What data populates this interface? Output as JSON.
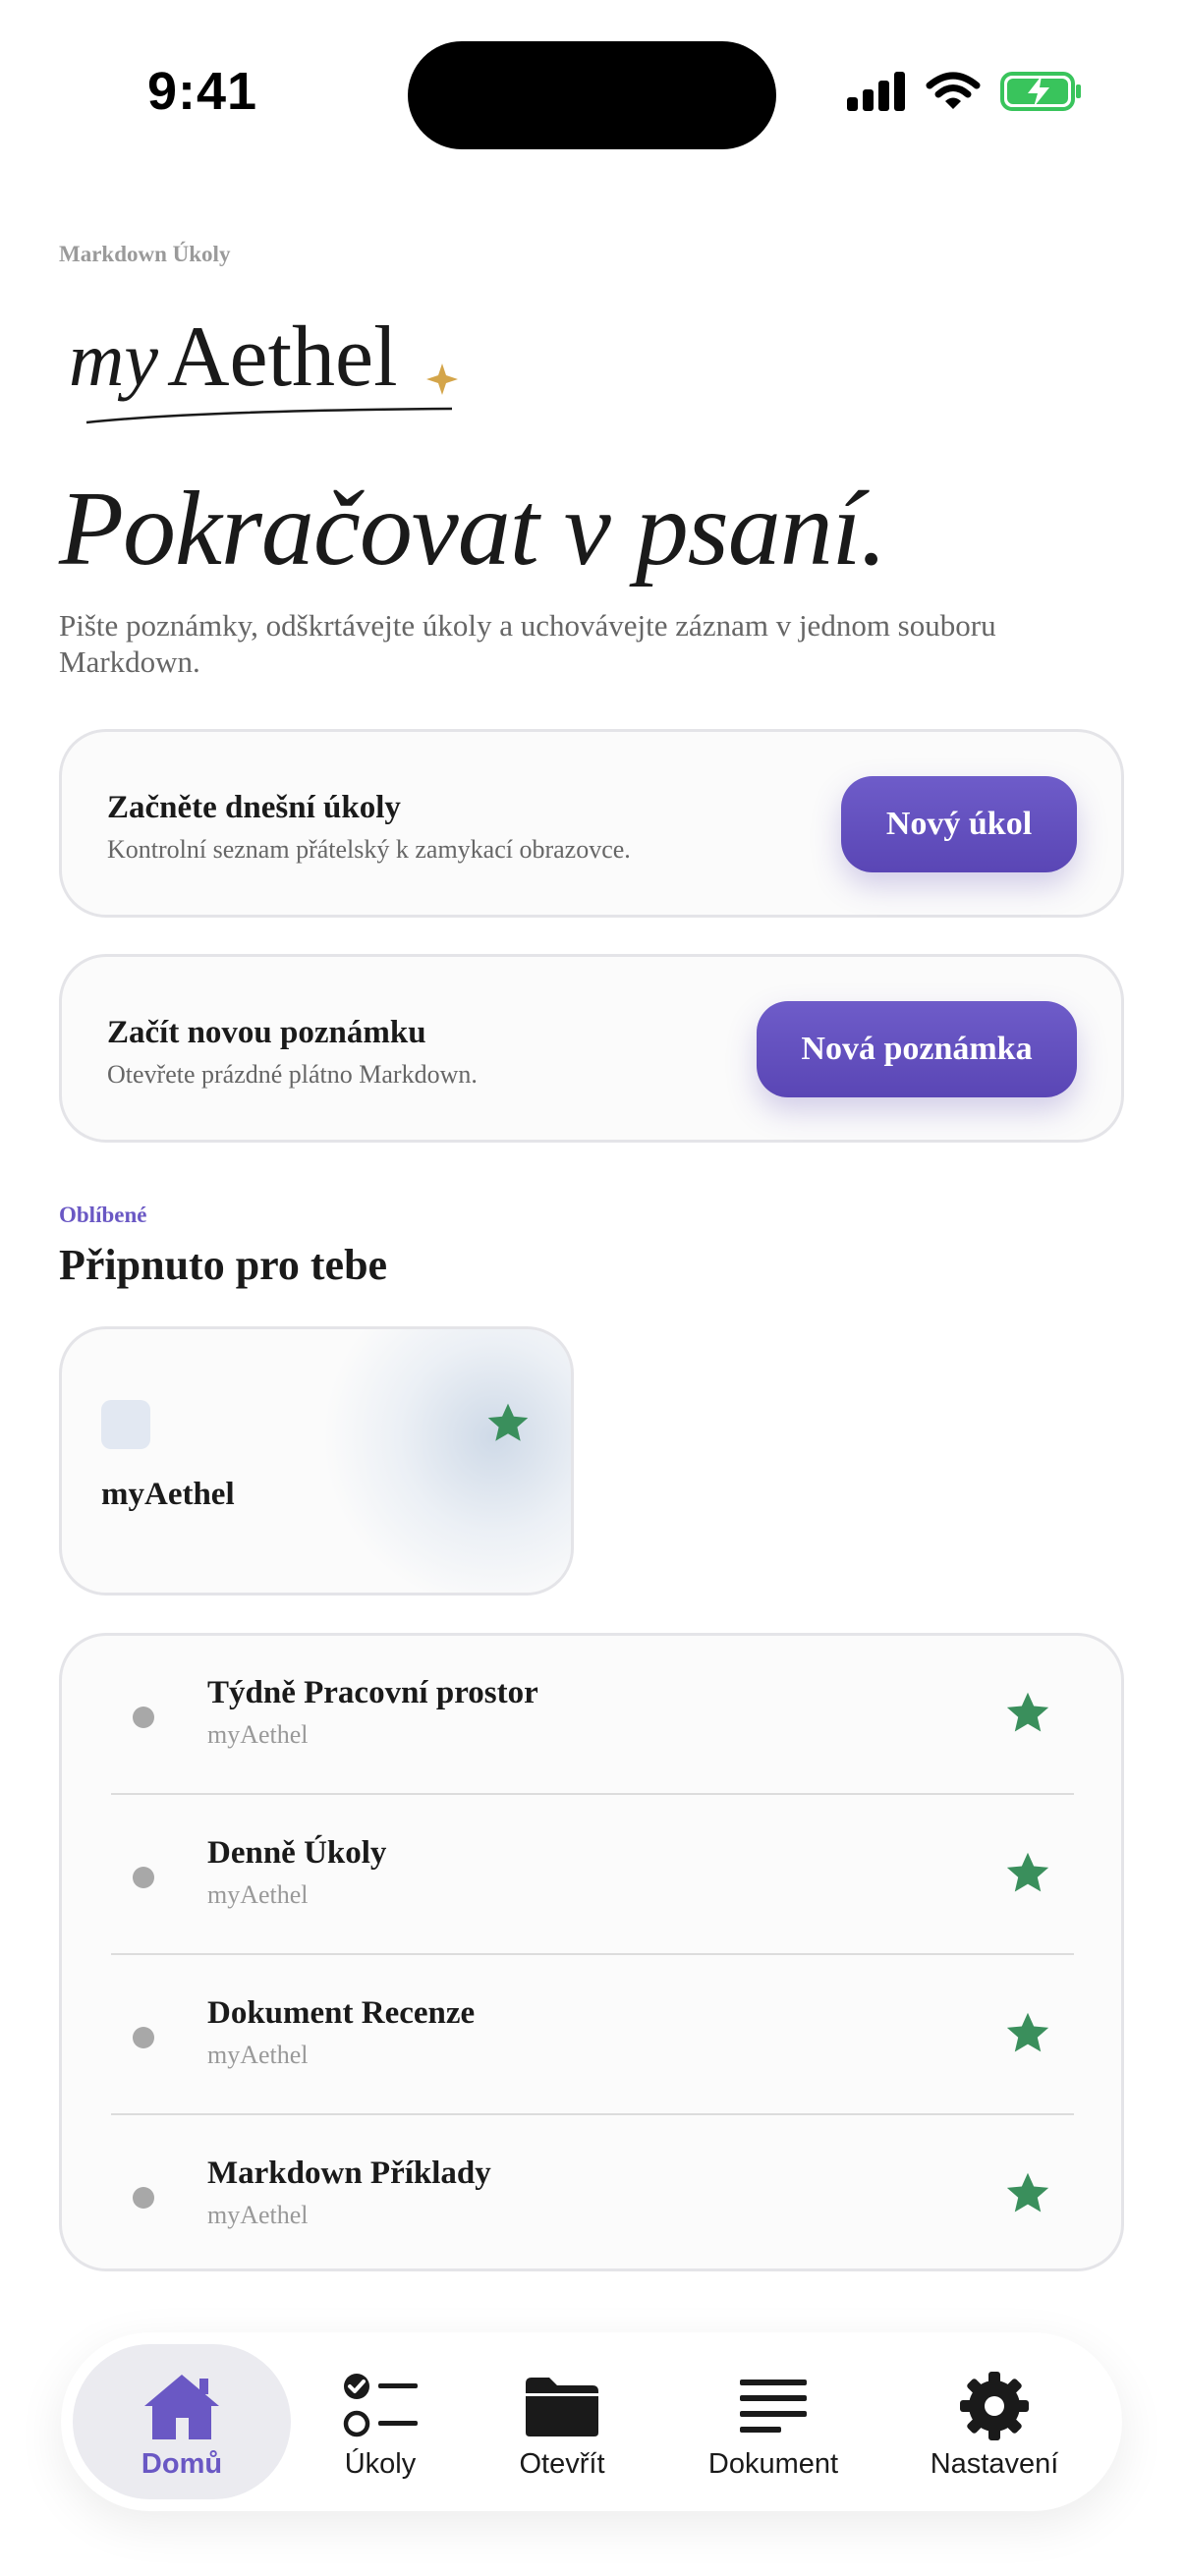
{
  "status_bar": {
    "time": "9:41"
  },
  "header": {
    "eyebrow": "Markdown Úkoly",
    "logo_text": "myAethel",
    "title": "Pokračovat v psaní.",
    "subtitle": "Pište poznámky, odškrtávejte úkoly a uchovávejte záznam v jednom souboru Markdown."
  },
  "cards": {
    "tasks": {
      "title": "Začněte dnešní úkoly",
      "description": "Kontrolní seznam přátelský k zamykací obrazovce.",
      "button": "Nový úkol"
    },
    "note": {
      "title": "Začít novou poznámku",
      "description": "Otevřete prázdné plátno Markdown.",
      "button": "Nová poznámka"
    }
  },
  "favorites": {
    "eyebrow": "Oblíbené",
    "title": "Připnuto pro tebe",
    "pinned": {
      "label": "myAethel"
    },
    "items": [
      {
        "title": "Týdně Pracovní prostor",
        "subtitle": "myAethel"
      },
      {
        "title": "Denně Úkoly",
        "subtitle": "myAethel"
      },
      {
        "title": "Dokument Recenze",
        "subtitle": "myAethel"
      },
      {
        "title": "Markdown Příklady",
        "subtitle": "myAethel"
      }
    ]
  },
  "tab_bar": {
    "tabs": [
      {
        "label": "Domů",
        "icon": "home-icon",
        "active": true
      },
      {
        "label": "Úkoly",
        "icon": "checklist-icon"
      },
      {
        "label": "Otevřít",
        "icon": "folder-icon"
      },
      {
        "label": "Dokument",
        "icon": "document-lines-icon"
      },
      {
        "label": "Nastavení",
        "icon": "gear-icon"
      }
    ]
  },
  "colors": {
    "accent": "#5f4bbd",
    "star": "#3a8f5c",
    "gold": "#d4a54a"
  }
}
